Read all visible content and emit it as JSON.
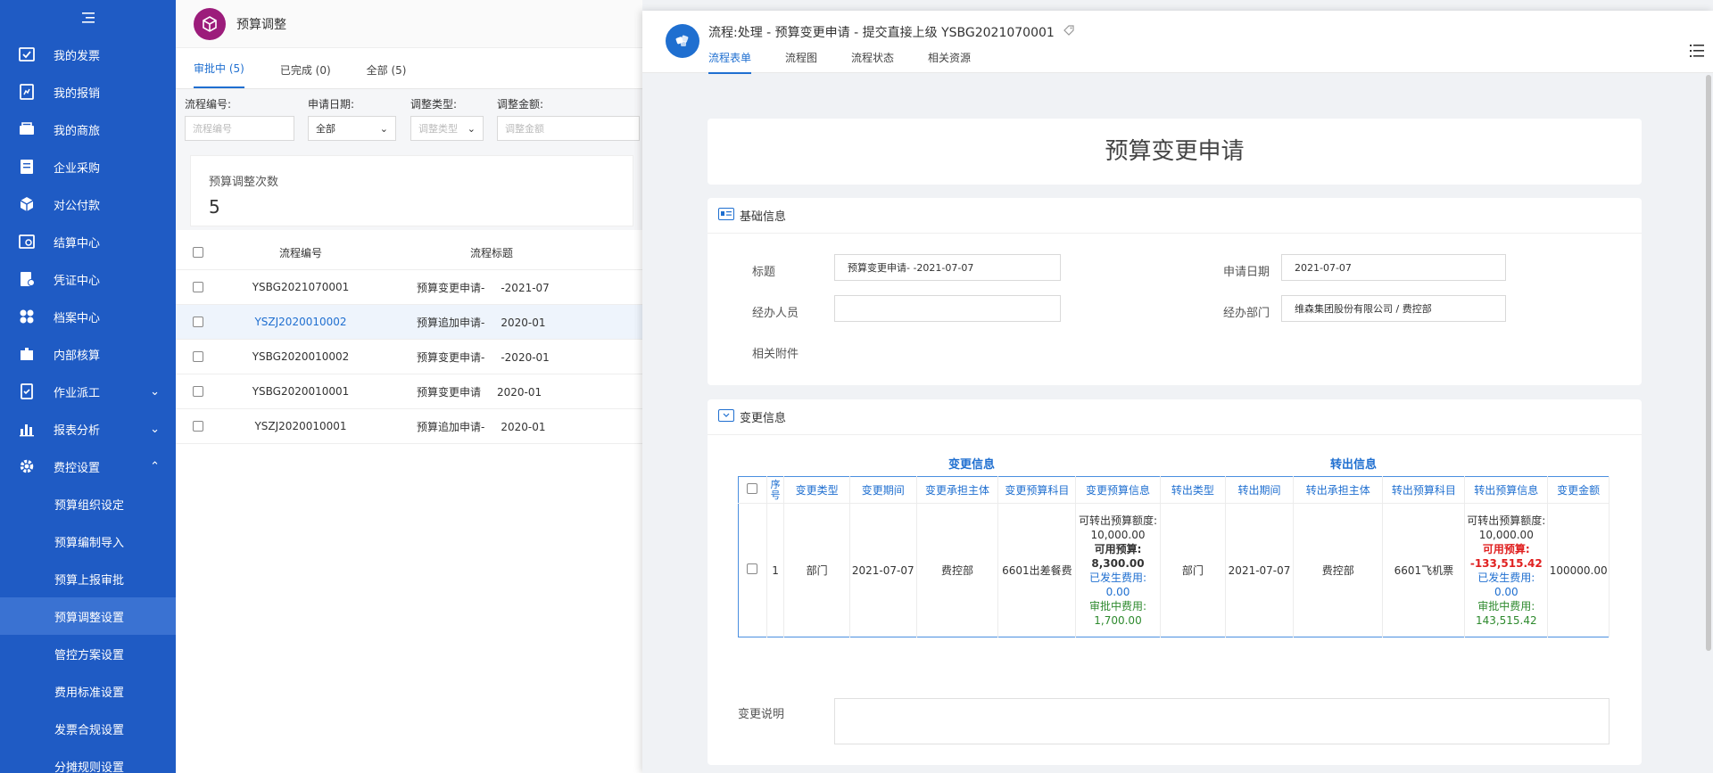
{
  "sidebar": {
    "items": [
      {
        "label": "我的发票",
        "icon": "invoice-icon"
      },
      {
        "label": "我的报销",
        "icon": "reimburse-icon"
      },
      {
        "label": "我的商旅",
        "icon": "travel-icon"
      },
      {
        "label": "企业采购",
        "icon": "purchase-icon"
      },
      {
        "label": "对公付款",
        "icon": "payment-icon"
      },
      {
        "label": "结算中心",
        "icon": "settlement-icon"
      },
      {
        "label": "凭证中心",
        "icon": "voucher-icon"
      },
      {
        "label": "档案中心",
        "icon": "archive-icon"
      },
      {
        "label": "内部核算",
        "icon": "accounting-icon"
      },
      {
        "label": "作业派工",
        "icon": "dispatch-icon"
      },
      {
        "label": "报表分析",
        "icon": "report-icon"
      },
      {
        "label": "费控设置",
        "icon": "gear-icon"
      }
    ],
    "subitems": [
      "预算组织设定",
      "预算编制导入",
      "预算上报审批",
      "预算调整设置",
      "管控方案设置",
      "费用标准设置",
      "发票合规设置",
      "分摊规则设置"
    ]
  },
  "page": {
    "title": "预算调整",
    "tabs": [
      "审批中 (5)",
      "已完成 (0)",
      "全部 (5)"
    ],
    "filters": {
      "code_label": "流程编号:",
      "code_placeholder": "流程编号",
      "date_label": "申请日期:",
      "date_value": "全部",
      "type_label": "调整类型:",
      "type_placeholder": "调整类型",
      "amount_label": "调整金额:",
      "amount_placeholder": "调整金额"
    },
    "stat": {
      "label": "预算调整次数",
      "value": "5"
    },
    "table": {
      "headers": [
        "流程编号",
        "流程标题"
      ],
      "rows": [
        {
          "code": "YSBG2021070001",
          "title": "预算变更申请-",
          "date": "-2021-07"
        },
        {
          "code": "YSZJ2020010002",
          "title": "预算追加申请-",
          "date": "2020-01"
        },
        {
          "code": "YSBG2020010002",
          "title": "预算变更申请-",
          "date": "-2020-01"
        },
        {
          "code": "YSBG2020010001",
          "title": "预算变更申请",
          "date": "2020-01"
        },
        {
          "code": "YSZJ2020010001",
          "title": "预算追加申请-",
          "date": "2020-01"
        }
      ]
    }
  },
  "panel": {
    "title": "流程:处理 - 预算变更申请 - 提交直接上级 YSBG2021070001",
    "tabs": [
      "流程表单",
      "流程图",
      "流程状态",
      "相关资源"
    ],
    "form_title": "预算变更申请",
    "basic": {
      "section": "基础信息",
      "title_label": "标题",
      "title_value": "预算变更申请-          -2021-07-07",
      "date_label": "申请日期",
      "date_value": "2021-07-07",
      "person_label": "经办人员",
      "person_value": "",
      "dept_label": "经办部门",
      "dept_value": "维森集团股份有限公司 / 费控部",
      "attach_label": "相关附件"
    },
    "change": {
      "section": "变更信息",
      "group_change": "变更信息",
      "group_out": "转出信息",
      "headers": [
        "序号",
        "变更类型",
        "变更期间",
        "变更承担主体",
        "变更预算科目",
        "变更预算信息",
        "转出类型",
        "转出期间",
        "转出承担主体",
        "转出预算科目",
        "转出预算信息",
        "变更金额"
      ],
      "row": {
        "no": "1",
        "type": "部门",
        "period": "2021-07-07",
        "subject": "费控部",
        "account": "6601出差餐费",
        "info_a": "可转出预算额度: 10,000.00",
        "info_b": "可用预算: 8,300.00",
        "info_c": "已发生费用: 0.00",
        "info_d": "审批中费用: 1,700.00",
        "out_type": "部门",
        "out_period": "2021-07-07",
        "out_subject": "费控部",
        "out_account": "6601飞机票",
        "out_a": "可转出预算额度: 10,000.00",
        "out_b": "可用预算: -133,515.42",
        "out_c": "已发生费用: 0.00",
        "out_d": "审批中费用: 143,515.42",
        "amount": "100000.00"
      },
      "note_label": "变更说明"
    }
  }
}
